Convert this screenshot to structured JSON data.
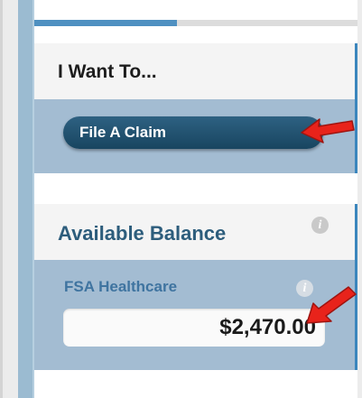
{
  "progress": {
    "fraction": 0.44
  },
  "want_card": {
    "title": "I Want To...",
    "claim_button_label": "File A Claim"
  },
  "balance_card": {
    "title": "Available Balance",
    "account_label": "FSA Healthcare",
    "amount": "$2,470.00",
    "info_icon": "i"
  },
  "icons": {
    "info": "info-icon",
    "arrow": "red-arrow-icon"
  },
  "colors": {
    "accent": "#3b86bd",
    "button": "#1e4f6e",
    "card_body": "#a3bcd2",
    "balance_title": "#2d5d7c",
    "annotation_arrow": "#e8231b"
  }
}
